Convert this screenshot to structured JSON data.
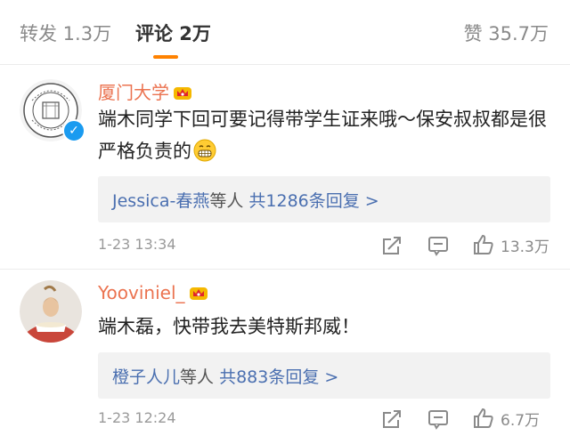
{
  "tabs": {
    "repost": "转发 1.3万",
    "comments": "评论 2万",
    "likes": "赞 35.7万"
  },
  "comments": [
    {
      "username": "厦门大学",
      "text": "端木同学下回可要记得带学生证来哦～保安叔叔都是很严格负责的",
      "replies_names": "Jessica-春燕",
      "replies_mid": "等人",
      "replies_count": "共1286条回复 >",
      "time": "1-23 13:34",
      "likes": "13.3万"
    },
    {
      "username": "Yooviniel_",
      "text": "端木磊，快带我去美特斯邦威！",
      "replies_names": "橙子人儿",
      "replies_mid": "等人",
      "replies_count": "共883条回复 >",
      "time": "1-23 12:24",
      "likes": "6.7万"
    }
  ],
  "colors": {
    "accent": "#ff8200",
    "username": "#eb7350",
    "link": "#4a6fb0",
    "verified": "#1a9bf0"
  }
}
